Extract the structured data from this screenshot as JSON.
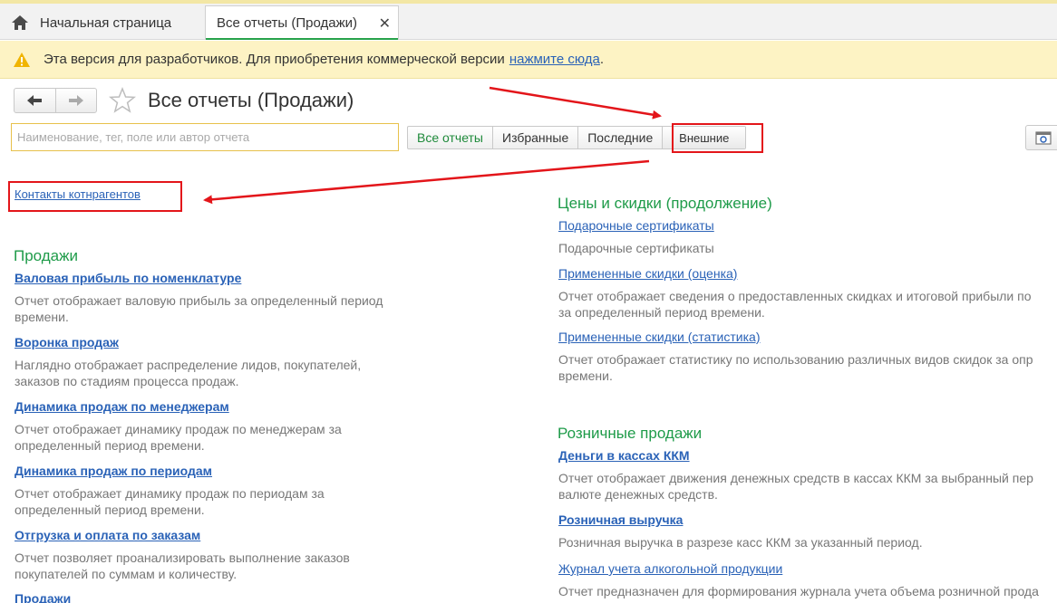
{
  "tabs": {
    "home_label": "Начальная страница",
    "active_label": "Все отчеты (Продажи)"
  },
  "warning": {
    "text": "Эта версия для разработчиков. Для приобретения коммерческой версии",
    "link": "нажмите сюда",
    "tail": "."
  },
  "header": {
    "title": "Все отчеты (Продажи)"
  },
  "search": {
    "placeholder": "Наименование, тег, поле или автор отчета"
  },
  "filters": [
    "Все отчеты",
    "Избранные",
    "Последние",
    "Внешние"
  ],
  "left": {
    "top_link": "Контакты котнрагентов",
    "section_title": "Продажи",
    "items": [
      {
        "title": "Валовая прибыль по номенклатуре",
        "desc": "Отчет отображает валовую прибыль за определенный период\nвремени."
      },
      {
        "title": "Воронка продаж",
        "desc": "Наглядно отображает распределение лидов, покупателей,\nзаказов по стадиям процесса продаж."
      },
      {
        "title": "Динамика продаж по менеджерам",
        "desc": "Отчет отображает динамику продаж по менеджерам за\nопределенный период времени."
      },
      {
        "title": "Динамика продаж по периодам",
        "desc": "Отчет отображает динамику продаж по периодам за\nопределенный период времени."
      },
      {
        "title": "Отгрузка и оплата по заказам",
        "desc": "Отчет позволяет проанализировать выполнение заказов\nпокупателей по суммам и количеству."
      },
      {
        "title": "Продажи",
        "desc": ""
      }
    ]
  },
  "right": {
    "section1_title": "Цены и скидки (продолжение)",
    "section1_items": [
      {
        "title": "Подарочные сертификаты",
        "desc": "Подарочные сертификаты"
      },
      {
        "title": "Примененные скидки (оценка)",
        "desc": "Отчет отображает сведения о предоставленных скидках и итоговой прибыли по\nза определенный период времени."
      },
      {
        "title": "Примененные скидки (статистика)",
        "desc": "Отчет отображает статистику по использованию различных видов скидок за опр\nвремени."
      }
    ],
    "section2_title": "Розничные продажи",
    "section2_items": [
      {
        "title": "Деньги в кассах ККМ",
        "desc": "Отчет отображает движения денежных средств в кассах ККМ за выбранный пер\nвалюте денежных средств."
      },
      {
        "title": "Розничная выручка",
        "desc": "Розничная выручка в разрезе касс ККМ за указанный период."
      },
      {
        "title": "Журнал учета алкогольной продукции",
        "desc": "Отчет предназначен для формирования журнала учета объема розничной прода"
      }
    ]
  },
  "colors": {
    "accent_green": "#1e9b49",
    "link_blue": "#2a62b7",
    "highlight_red": "#e3151a",
    "warning_bg": "#fdf3c4"
  }
}
